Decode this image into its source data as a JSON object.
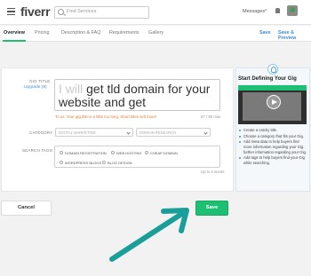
{
  "header": {
    "logo": "fiverr",
    "search_placeholder": "Find Services",
    "messages": "Messages°"
  },
  "tabs": [
    {
      "label": "Overview"
    },
    {
      "label": "Pricing"
    },
    {
      "label": "Description & FAQ"
    },
    {
      "label": "Requirements"
    },
    {
      "label": "Gallery"
    }
  ],
  "actions": {
    "save": "Save",
    "save_preview": "Save & Preview"
  },
  "form": {
    "gig_title_label": "GIG TITLE",
    "upgrade_link": "Upgrade (8)",
    "title_prefix": "I will",
    "title_text": "get tld domain for your website and get",
    "title_warning": "To us: Your gig title is a little too long. Short titles sell more!",
    "title_counter": "87 / 80 max",
    "category_label": "CATEGORY",
    "category_value": "DIGITAL MARKETING",
    "subcategory_value": "DOMAIN RESEARCH",
    "search_tags_label": "SEARCH TAGS",
    "tags": [
      "DOMAIN REGISTRATION",
      "WEB HOSTING",
      "CHEAP DOMAIN",
      "WORDPRESS BLOGS",
      "BLOG DESIGN"
    ],
    "tags_limit": "Up to 5 words"
  },
  "sidebar": {
    "title": "Start Defining Your Gig",
    "tips": [
      "Create a catchy title.",
      "Choose a category that fits your Gig.",
      "Add meta data to help buyers find more information regarding your Gig. further information regarding your Gig.",
      "Add tags to help buyers find your Gig while searching."
    ]
  },
  "footer": {
    "cancel": "Cancel",
    "save": "Save"
  },
  "colors": {
    "accent": "#1dbf73",
    "link": "#3b8dd4",
    "arrow": "#1a9e9a",
    "warning": "#e07b39"
  }
}
